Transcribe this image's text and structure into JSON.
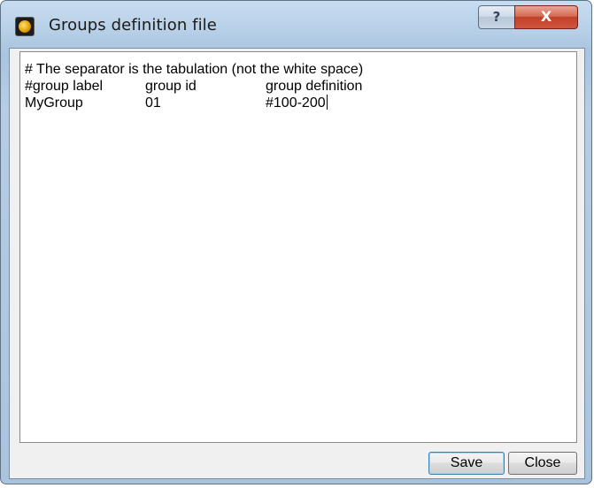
{
  "window": {
    "title": "Groups definition file",
    "help_button": "?",
    "close_button": "X"
  },
  "editor": {
    "comment_line": "# The separator is the tabulation (not the white space)",
    "header": {
      "col1": "#group label",
      "col2": "group id",
      "col3": "group definition"
    },
    "row": {
      "col1": "MyGroup",
      "col2": "01",
      "col3": "#100-200"
    }
  },
  "buttons": {
    "save_label": "Save",
    "close_label": "Close"
  },
  "icons": {
    "app": "app-icon"
  }
}
